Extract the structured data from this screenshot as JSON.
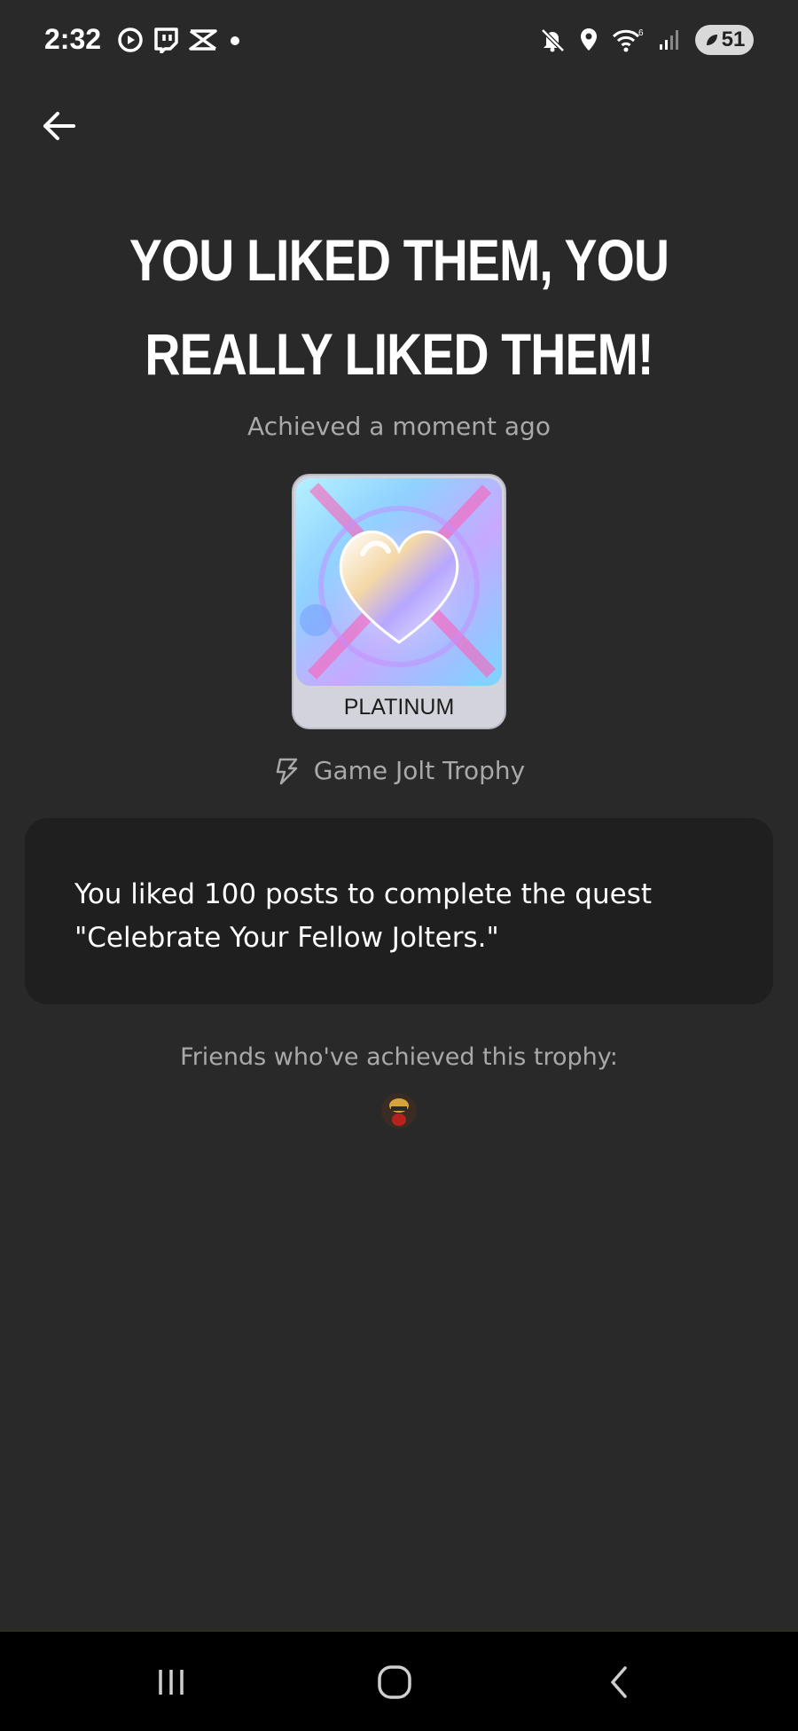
{
  "status_bar": {
    "time": "2:32",
    "battery": "51",
    "wifi_label": "6",
    "left_icons": [
      "play-circle-icon",
      "twitch-icon",
      "capcut-icon",
      "dot-icon"
    ],
    "right_icons": [
      "mute-icon",
      "location-icon",
      "wifi-icon",
      "signal-icon",
      "battery-icon"
    ]
  },
  "header": {
    "back_icon": "arrow-left-icon"
  },
  "trophy": {
    "title": "YOU LIKED THEM, YOU REALLY LIKED THEM!",
    "achieved": "Achieved a moment ago",
    "tier": "PLATINUM",
    "source_icon": "jolt-bolt-icon",
    "source": "Game Jolt Trophy",
    "description": "You liked 100 posts to complete the quest \"Celebrate Your Fellow Jolters.\""
  },
  "friends": {
    "label": "Friends who've achieved this trophy:",
    "count_shown": 1
  },
  "nav": {
    "icons": [
      "recent-apps-icon",
      "home-icon",
      "back-icon"
    ]
  },
  "colors": {
    "background": "#292929",
    "panel": "#1f1f1f",
    "muted_text": "#a9a9a9",
    "trophy_card": "#d3d3dc"
  }
}
